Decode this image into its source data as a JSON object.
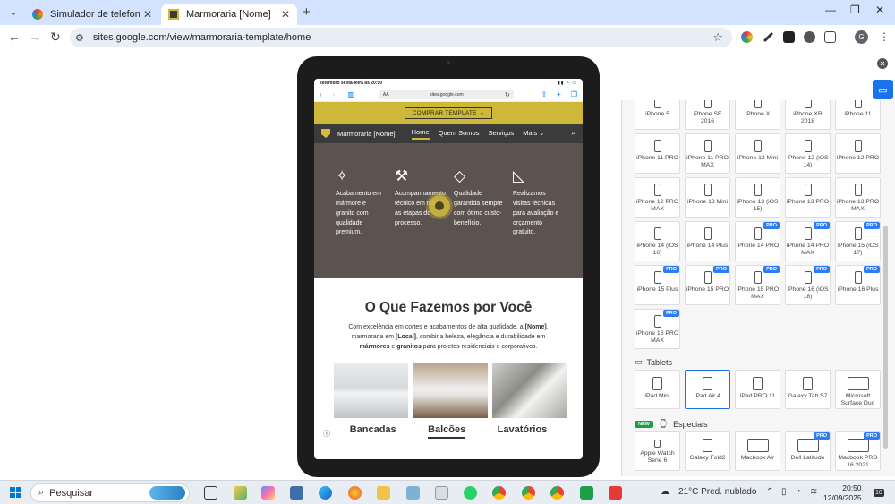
{
  "browser": {
    "tabs": [
      {
        "title": "Simulador de telefone móvel - ",
        "active": false
      },
      {
        "title": "Marmoraria [Nome]",
        "active": true
      }
    ],
    "url": "sites.google.com/view/marmoraria-template/home",
    "avatar_letter": "G"
  },
  "device_screen": {
    "status_time": "setembro sexta-feira às 20:50",
    "status_icons": "▮▮ ◔ ▭",
    "address": "sites.google.com",
    "aa": "AA",
    "promo_button": "COMPRAR TEMPLATE →",
    "brand": "Marmoraria [Nome]",
    "nav": [
      "Home",
      "Quem Somos",
      "Serviços",
      "Mais ⌄"
    ],
    "features": [
      {
        "icon": "sparkles-icon",
        "glyph": "✧",
        "text": "Acabamento em mármore e granito com qualidade premium."
      },
      {
        "icon": "wrench-icon",
        "glyph": "⚒",
        "text": "Acompanhamento técnico em todas as etapas do processo."
      },
      {
        "icon": "diamond-icon",
        "glyph": "◇",
        "text": "Qualidade garantida sempre com ótimo custo-benefício."
      },
      {
        "icon": "set-square-icon",
        "glyph": "◺",
        "text": "Realizamos visitas técnicas para avaliação e orçamento gratuito."
      }
    ],
    "section_title": "O Que Fazemos por Você",
    "section_text_parts": [
      "Com excelência em cortes e acabamentos de alta qualidade, a ",
      "[Nome]",
      ", marmoraria em ",
      "[Local]",
      ", combina beleza, elegância e durabilidade em ",
      "mármores",
      " e ",
      "granitos",
      " para projetos residenciais e corporativos."
    ],
    "categories": [
      "Bancadas",
      "Balcões",
      "Lavatórios"
    ],
    "selected_category": "Balcões"
  },
  "device_panel": {
    "phones": [
      {
        "label": "iPhone 5",
        "pro": false
      },
      {
        "label": "iPhone SE 2016",
        "pro": false
      },
      {
        "label": "iPhone X",
        "pro": false
      },
      {
        "label": "iPhone XR 2018",
        "pro": false
      },
      {
        "label": "iPhone 11",
        "pro": false
      },
      {
        "label": "iPhone 11 PRO",
        "pro": false
      },
      {
        "label": "iPhone 11 PRO MAX",
        "pro": false
      },
      {
        "label": "iPhone 12 Mini",
        "pro": false
      },
      {
        "label": "iPhone 12 (iOS 14)",
        "pro": false
      },
      {
        "label": "iPhone 12 PRO",
        "pro": false
      },
      {
        "label": "iPhone 12 PRO MAX",
        "pro": false
      },
      {
        "label": "iPhone 13 Mini",
        "pro": false
      },
      {
        "label": "iPhone 13 (iOS 15)",
        "pro": false
      },
      {
        "label": "iPhone 13 PRO",
        "pro": false
      },
      {
        "label": "iPhone 13 PRO MAX",
        "pro": false
      },
      {
        "label": "iPhone 14 (iOS 16)",
        "pro": false
      },
      {
        "label": "iPhone 14 Plus",
        "pro": false
      },
      {
        "label": "iPhone 14 PRO",
        "pro": true
      },
      {
        "label": "iPhone 14 PRO MAX",
        "pro": true
      },
      {
        "label": "iPhone 15 (iOS 17)",
        "pro": true
      },
      {
        "label": "iPhone 15 Plus",
        "pro": true
      },
      {
        "label": "iPhone 15 PRO",
        "pro": true
      },
      {
        "label": "iPhone 15 PRO MAX",
        "pro": true
      },
      {
        "label": "iPhone 16 (iOS 18)",
        "pro": true
      },
      {
        "label": "iPhone 16 Plus",
        "pro": true
      },
      {
        "label": "iPhone 16 PRO MAX",
        "pro": true
      }
    ],
    "tablets_heading": "Tablets",
    "tablets": [
      {
        "label": "iPad Mini",
        "selected": false
      },
      {
        "label": "iPad Air 4",
        "selected": true
      },
      {
        "label": "iPad PRO 11",
        "selected": false
      },
      {
        "label": "Galaxy Tab S7",
        "selected": false
      },
      {
        "label": "Microsoft Surface Duo",
        "selected": false
      }
    ],
    "special_badge": "NEW",
    "special_heading": "Especiais",
    "specials": [
      {
        "label": "Apple Watch Serie 6",
        "pro": false
      },
      {
        "label": "Galaxy Fold2",
        "pro": false
      },
      {
        "label": "Macbook Air",
        "pro": false
      },
      {
        "label": "Dell Latitude",
        "pro": true
      },
      {
        "label": "Macbook PRO 16 2021",
        "pro": true
      }
    ],
    "pro_label": "PRO"
  },
  "taskbar": {
    "search_placeholder": "Pesquisar",
    "weather": "21°C  Pred. nublado",
    "time": "20:50",
    "date": "12/09/2025",
    "notif_count": "10"
  }
}
